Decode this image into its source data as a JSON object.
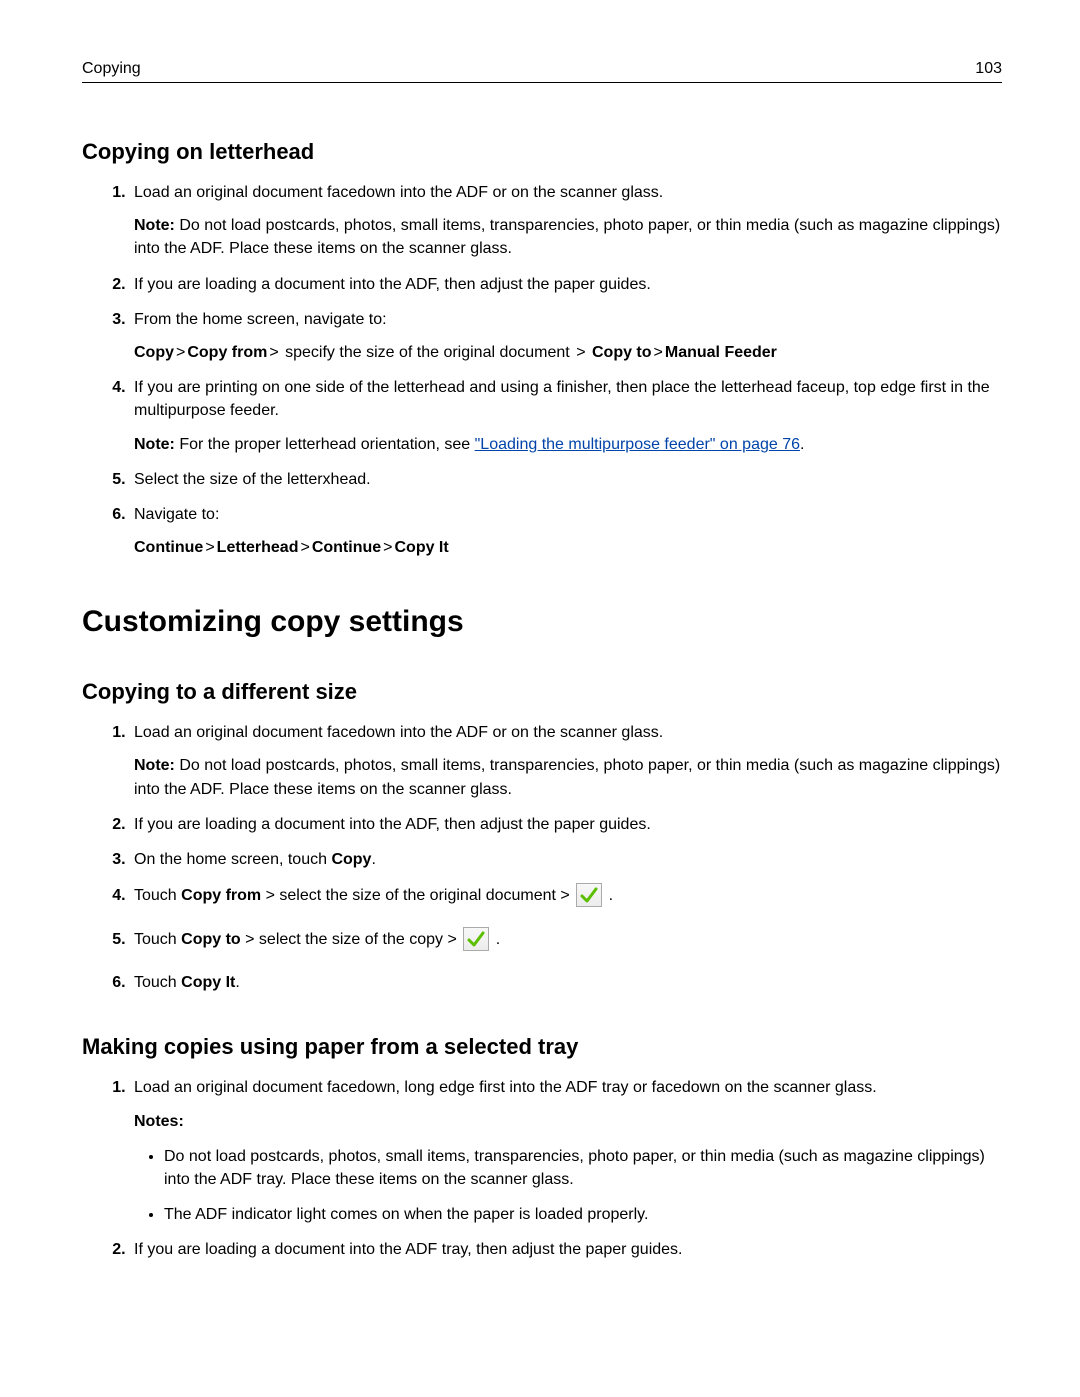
{
  "header": {
    "section": "Copying",
    "page": "103"
  },
  "sec1": {
    "title": "Copying on letterhead",
    "s1": "Load an original document facedown into the ADF or on the scanner glass.",
    "s1_note_label": "Note:",
    "s1_note": " Do not load postcards, photos, small items, transparencies, photo paper, or thin media (such as magazine clippings) into the ADF. Place these items on the scanner glass.",
    "s2": "If you are loading a document into the ADF, then adjust the paper guides.",
    "s3": "From the home screen, navigate to:",
    "s3_nav_copy": "Copy",
    "s3_nav_copyfrom": "Copy from",
    "s3_nav_mid": " specify the size of the original document ",
    "s3_nav_copyto": "Copy to",
    "s3_nav_manual": "Manual Feeder",
    "s4": "If you are printing on one side of the letterhead and using a finisher, then place the letterhead faceup, top edge first in the multipurpose feeder.",
    "s4_note_label": "Note:",
    "s4_note_pre": " For the proper letterhead orientation, see ",
    "s4_link": "\"Loading the multipurpose feeder\" on page 76",
    "s4_note_post": ".",
    "s5": "Select the size of the letterxhead.",
    "s6": "Navigate to:",
    "s6_a": "Continue",
    "s6_b": "Letterhead",
    "s6_c": "Continue",
    "s6_d": "Copy It",
    "gt": ">"
  },
  "main2": {
    "title": "Customizing copy settings"
  },
  "sec2": {
    "title": "Copying to a different size",
    "s1": "Load an original document facedown into the ADF or on the scanner glass.",
    "s1_note_label": "Note:",
    "s1_note": " Do not load postcards, photos, small items, transparencies, photo paper, or thin media (such as magazine clippings) into the ADF. Place these items on the scanner glass.",
    "s2": "If you are loading a document into the ADF, then adjust the paper guides.",
    "s3_pre": "On the home screen, touch ",
    "s3_b": "Copy",
    "s3_post": ".",
    "s4_pre": "Touch ",
    "s4_b": "Copy from",
    "s4_mid": " > select the size of the original document > ",
    "s4_post": " .",
    "s5_pre": "Touch ",
    "s5_b": "Copy to",
    "s5_mid": " > select the size of the copy > ",
    "s5_post": " .",
    "s6_pre": "Touch ",
    "s6_b": "Copy It",
    "s6_post": "."
  },
  "sec3": {
    "title": "Making copies using paper from a selected tray",
    "s1": "Load an original document facedown, long edge first into the ADF tray or facedown on the scanner glass.",
    "notes_label": "Notes:",
    "b1": "Do not load postcards, photos, small items, transparencies, photo paper, or thin media (such as magazine clippings) into the ADF tray. Place these items on the scanner glass.",
    "b2": "The ADF indicator light comes on when the paper is loaded properly.",
    "s2": "If you are loading a document into the ADF tray, then adjust the paper guides."
  }
}
